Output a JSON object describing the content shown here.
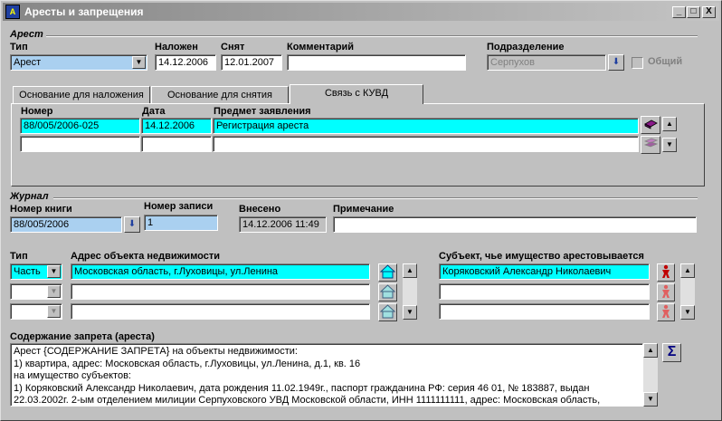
{
  "window": {
    "title": "Аресты и запрещения"
  },
  "arest": {
    "group_label": "Арест",
    "type_label": "Тип",
    "type_value": "Арест",
    "imposed_label": "Наложен",
    "imposed_value": "14.12.2006",
    "removed_label": "Снят",
    "removed_value": "12.01.2007",
    "comment_label": "Комментарий",
    "comment_value": "",
    "division_label": "Подразделение",
    "division_value": "Серпухов",
    "common_label": "Общий"
  },
  "tabs": [
    {
      "label": "Основание для наложения"
    },
    {
      "label": "Основание для снятия"
    },
    {
      "label": "Связь с КУВД"
    }
  ],
  "kuvd": {
    "columns": [
      "Номер",
      "Дата",
      "Предмет заявления"
    ],
    "rows": [
      {
        "number": "88/005/2006-025",
        "date": "14.12.2006",
        "subject": "Регистрация ареста"
      },
      {
        "number": "",
        "date": "",
        "subject": ""
      }
    ]
  },
  "journal": {
    "group_label": "Журнал",
    "book_label": "Номер книги",
    "book_value": "88/005/2006",
    "record_label": "Номер записи",
    "record_value": "1",
    "entered_label": "Внесено",
    "entered_value": "14.12.2006 11:49",
    "note_label": "Примечание",
    "note_value": ""
  },
  "property": {
    "type_label": "Тип",
    "address_label": "Адрес объекта недвижимости",
    "rows": [
      {
        "type": "Часть",
        "address": "Московская область, г.Луховицы, ул.Ленина"
      },
      {
        "type": "",
        "address": ""
      },
      {
        "type": "",
        "address": ""
      }
    ]
  },
  "subject": {
    "label": "Субъект, чье имущество арестовывается",
    "rows": [
      "Коряковский Александр Николаевич",
      "",
      ""
    ]
  },
  "content": {
    "label": "Содержание запрета (ареста)",
    "lines": [
      "Арест {СОДЕРЖАНИЕ ЗАПРЕТА}  на объекты недвижимости:",
      "1) квартира, адрес: Московская область, г.Луховицы, ул.Ленина, д.1, кв. 16",
      "на имущество субъектов:",
      "1) Коряковский Александр Николаевич, дата рождения 11.02.1949г., паспорт гражданина РФ: серия 46 01, № 183887, выдан",
      "22.03.2002г. 2-ым отделением милиции Серпуховского УВД Московской области, ИНН 1111111111, адрес: Московская область,"
    ],
    "sigma_glyph": "Σ"
  },
  "icons": {
    "min": "_",
    "max": "□",
    "close": "X",
    "down_arrow": "▼",
    "up_arrow": "▲",
    "blue_down_arrow": "⬇"
  },
  "colors": {
    "highlight": "#00ffff",
    "selected_blue": "#aad0f0",
    "title_gradient_start": "#868686"
  }
}
